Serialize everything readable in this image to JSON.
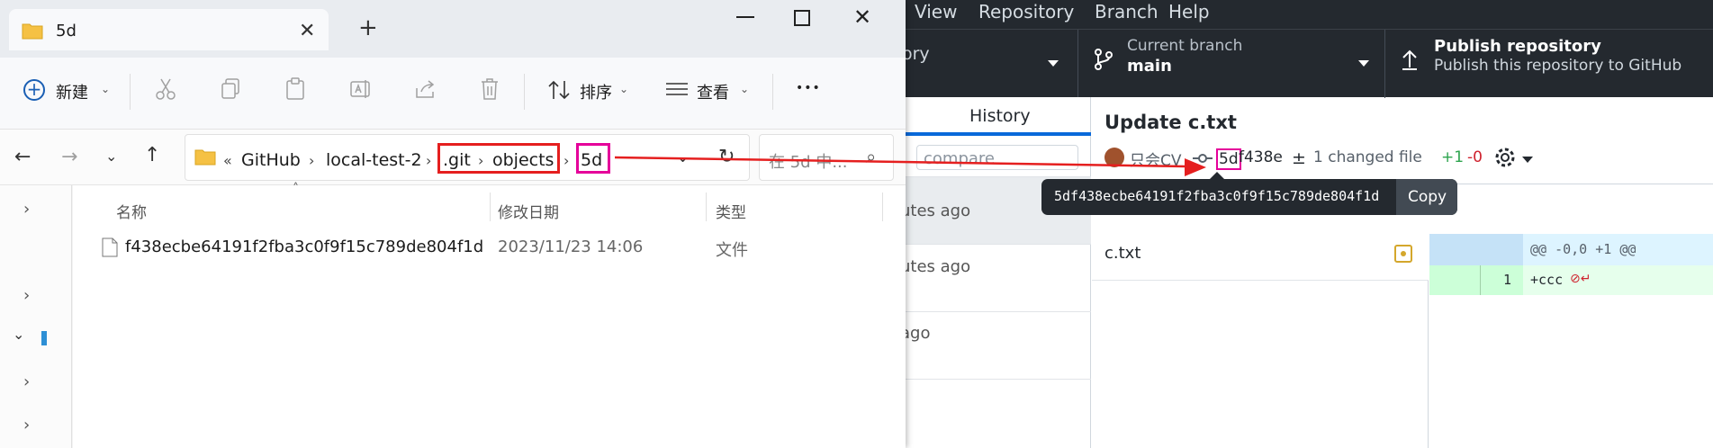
{
  "github": {
    "menu": [
      "View",
      "Repository",
      "Branch",
      "Help"
    ],
    "repo_partial": "ory",
    "branch": {
      "label": "Current branch",
      "value": "main"
    },
    "publish": {
      "label": "Publish repository",
      "sub": "Publish this repository to GitHub"
    },
    "tab_history": "History",
    "compare_placeholder": "compare",
    "history_times": [
      "utes ago",
      "utes ago",
      "ago"
    ],
    "commit_title": "Update c.txt",
    "author": "只会CV",
    "sha_prefix": "5d",
    "sha_suffix": "f438e",
    "changed_files": "1 changed file",
    "additions": "+1",
    "deletions": "-0",
    "tooltip_sha": "5df438ecbe64191f2fba3c0f9f15c789de804f1d",
    "tooltip_copy": "Copy",
    "file": "c.txt",
    "hunk": "@@ -0,0 +1 @@",
    "line_number": "1",
    "line_text": "+ccc",
    "colors": {
      "toolbar": "#24292f",
      "add": "#2da44e",
      "del": "#cf222e",
      "accent": "#0969da",
      "marker": "#e5009a",
      "highlight": "#e51f1f"
    }
  },
  "explorer": {
    "tab_title": "5d",
    "new_tab_symbol": "+",
    "new_label": "新建",
    "sort_label": "排序",
    "view_label": "查看",
    "more": "•••",
    "breadcrumb_lead": "«",
    "breadcrumb": [
      "GitHub",
      "local-test-2",
      ".git",
      "objects",
      "5d"
    ],
    "search_placeholder": "在 5d 中...",
    "columns": {
      "name": "名称",
      "date": "修改日期",
      "type": "类型"
    },
    "file_row": {
      "name": "f438ecbe64191f2fba3c0f9f15c789de804f1d",
      "date": "2023/11/23 14:06",
      "type": "文件"
    }
  }
}
